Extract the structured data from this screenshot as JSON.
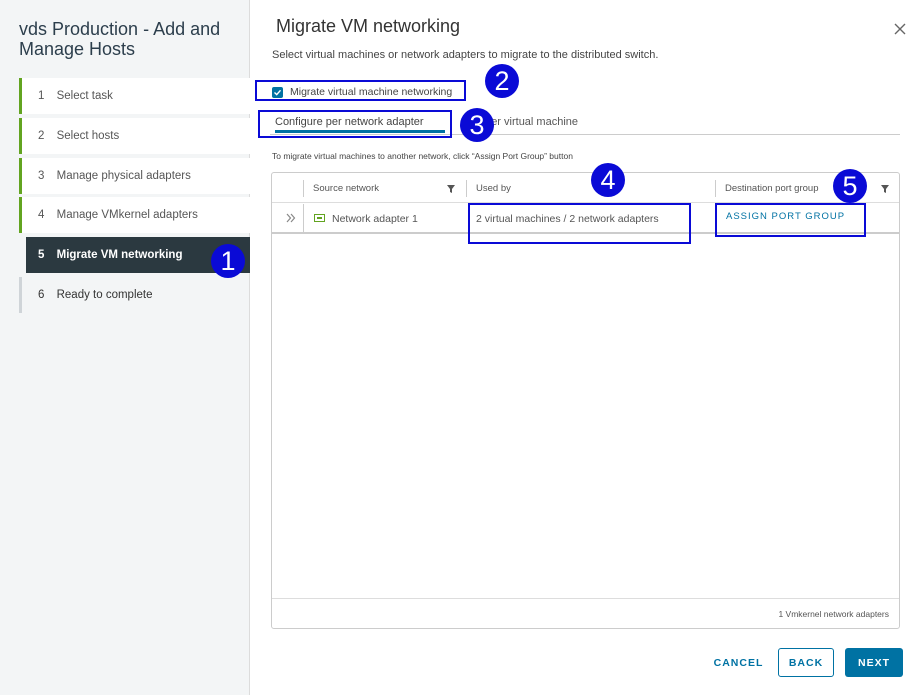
{
  "wizard": {
    "title": "vds Production - Add and Manage Hosts",
    "steps": [
      {
        "num": "1",
        "label": "Select task"
      },
      {
        "num": "2",
        "label": "Select hosts"
      },
      {
        "num": "3",
        "label": "Manage physical adapters"
      },
      {
        "num": "4",
        "label": "Manage VMkernel adapters"
      },
      {
        "num": "5",
        "label": "Migrate VM networking"
      },
      {
        "num": "6",
        "label": "Ready to complete"
      }
    ]
  },
  "main": {
    "title": "Migrate VM networking",
    "description": "Select virtual machines or network adapters to migrate to the distributed switch.",
    "checkbox_label": "Migrate virtual machine networking",
    "tabs": [
      {
        "label": "Configure per network adapter"
      },
      {
        "label": "gure per virtual machine"
      }
    ],
    "hint": "To migrate virtual machines to another network, click “Assign Port Group” button",
    "grid": {
      "headers": [
        "Source network",
        "Used by",
        "Destination port group"
      ],
      "row": {
        "source": "Network adapter 1",
        "used_by": "2 virtual machines / 2 network adapters",
        "action": "ASSIGN PORT GROUP"
      },
      "footer": "1 Vmkernel network adapters"
    }
  },
  "buttons": {
    "cancel": "CANCEL",
    "back": "BACK",
    "next": "NEXT"
  },
  "annotations": [
    "1",
    "2",
    "3",
    "4",
    "5"
  ],
  "colors": {
    "accent": "#0072a3",
    "complete": "#62a420",
    "annotation": "#0a0ad6"
  }
}
